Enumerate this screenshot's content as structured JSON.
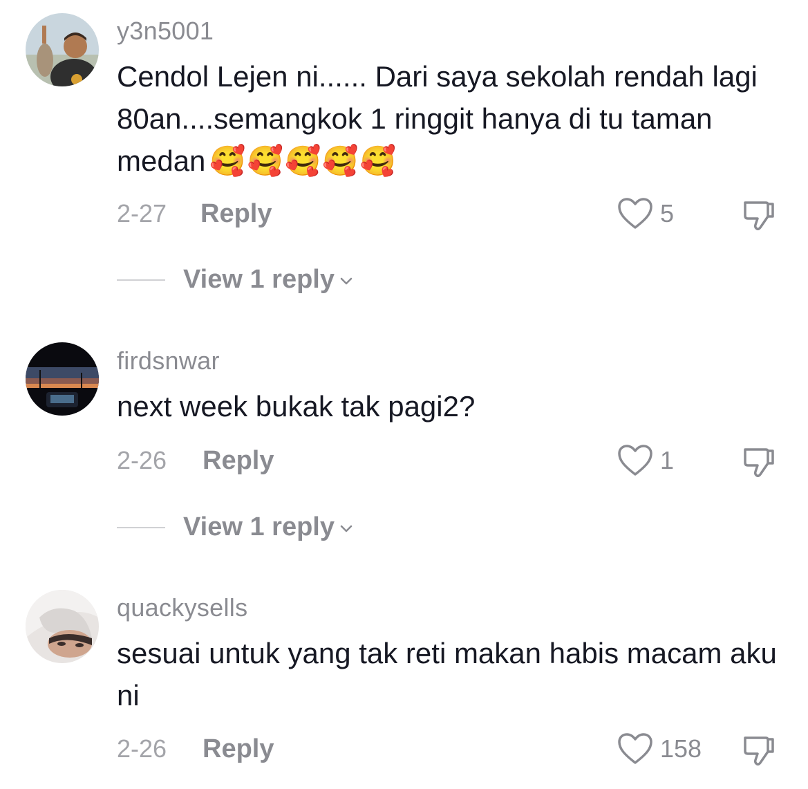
{
  "comments": [
    {
      "username": "y3n5001",
      "text": "Cendol Lejen ni...... Dari saya sekolah rendah lagi 80an....semangkok 1 ringgit hanya di tu taman medan",
      "emoji": "🥰🥰🥰🥰🥰",
      "date": "2-27",
      "reply_label": "Reply",
      "likes": "5",
      "view_replies": "View 1 reply"
    },
    {
      "username": "firdsnwar",
      "text": "next week bukak tak pagi2?",
      "emoji": "",
      "date": "2-26",
      "reply_label": "Reply",
      "likes": "1",
      "view_replies": "View 1 reply"
    },
    {
      "username": "quackysells",
      "text": "sesuai untuk yang tak reti makan habis macam aku ni",
      "emoji": "",
      "date": "2-26",
      "reply_label": "Reply",
      "likes": "158",
      "view_replies": ""
    }
  ],
  "icons": {
    "like": "heart-outline-icon",
    "dislike": "thumbs-down-icon",
    "expand": "chevron-down-icon"
  },
  "colors": {
    "text": "#161823",
    "muted": "#8a8b91"
  }
}
